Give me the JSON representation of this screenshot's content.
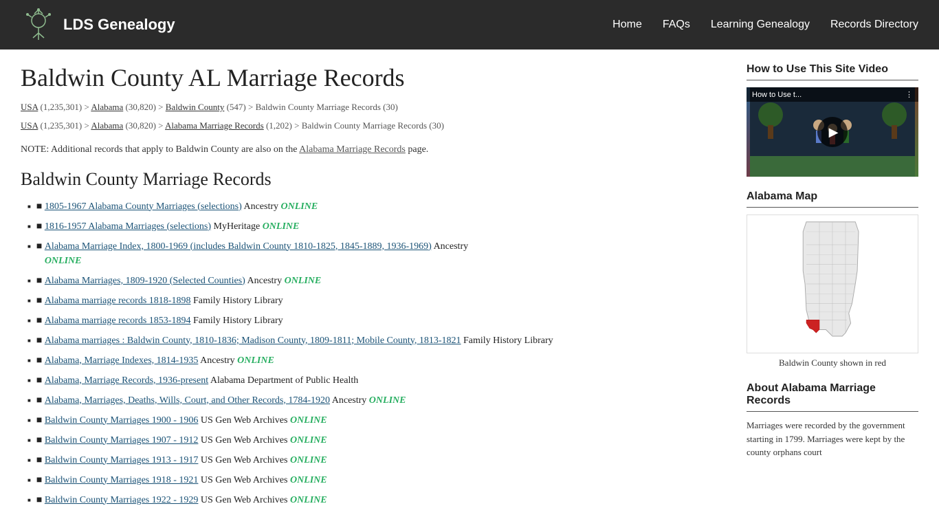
{
  "header": {
    "logo_text": "LDS Genealogy",
    "nav": [
      {
        "label": "Home",
        "href": "#"
      },
      {
        "label": "FAQs",
        "href": "#"
      },
      {
        "label": "Learning Genealogy",
        "href": "#"
      },
      {
        "label": "Records Directory",
        "href": "#"
      }
    ]
  },
  "page": {
    "title": "Baldwin County AL Marriage Records",
    "breadcrumbs": [
      {
        "line1": "USA (1,235,301) > Alabama (30,820) > Baldwin County (547) > Baldwin County Marriage Records (30)",
        "line2": "USA (1,235,301) > Alabama (30,820) > Alabama Marriage Records (1,202) > Baldwin County Marriage Records (30)"
      }
    ],
    "note": "NOTE: Additional records that apply to Baldwin County are also on the Alabama Marriage Records page.",
    "section_title": "Baldwin County Marriage Records",
    "records": [
      {
        "link": "1805-1967 Alabama County Marriages (selections)",
        "source": "Ancestry",
        "online": true
      },
      {
        "link": "1816-1957 Alabama Marriages (selections)",
        "source": "MyHeritage",
        "online": true
      },
      {
        "link": "Alabama Marriage Index, 1800-1969 (includes Baldwin County 1810-1825, 1845-1889, 1936-1969)",
        "source": "Ancestry",
        "online": true
      },
      {
        "link": "Alabama Marriages, 1809-1920 (Selected Counties)",
        "source": "Ancestry",
        "online": true
      },
      {
        "link": "Alabama marriage records 1818-1898",
        "source": "Family History Library",
        "online": false
      },
      {
        "link": "Alabama marriage records 1853-1894",
        "source": "Family History Library",
        "online": false
      },
      {
        "link": "Alabama marriages : Baldwin County, 1810-1836; Madison County, 1809-1811; Mobile County, 1813-1821",
        "source": "Family History Library",
        "online": false
      },
      {
        "link": "Alabama, Marriage Indexes, 1814-1935",
        "source": "Ancestry",
        "online": true
      },
      {
        "link": "Alabama, Marriage Records, 1936-present",
        "source": "Alabama Department of Public Health",
        "online": false
      },
      {
        "link": "Alabama, Marriages, Deaths, Wills, Court, and Other Records, 1784-1920",
        "source": "Ancestry",
        "online": true
      },
      {
        "link": "Baldwin County Marriages 1900 - 1906",
        "source": "US Gen Web Archives",
        "online": true
      },
      {
        "link": "Baldwin County Marriages 1907 - 1912",
        "source": "US Gen Web Archives",
        "online": true
      },
      {
        "link": "Baldwin County Marriages 1913 - 1917",
        "source": "US Gen Web Archives",
        "online": true
      },
      {
        "link": "Baldwin County Marriages 1918 - 1921",
        "source": "US Gen Web Archives",
        "online": true
      },
      {
        "link": "Baldwin County Marriages 1922 - 1929",
        "source": "US Gen Web Archives",
        "online": true
      }
    ]
  },
  "sidebar": {
    "video_section": {
      "title": "How to Use This Site Video",
      "video_label": "How to Use t...",
      "play_label": "▶"
    },
    "map_section": {
      "title": "Alabama Map",
      "caption": "Baldwin County shown in red"
    },
    "about_section": {
      "title": "About Alabama Marriage Records",
      "text": "Marriages were recorded by the government starting in 1799. Marriages were kept by the county orphans court"
    }
  },
  "online_label": "ONLINE"
}
